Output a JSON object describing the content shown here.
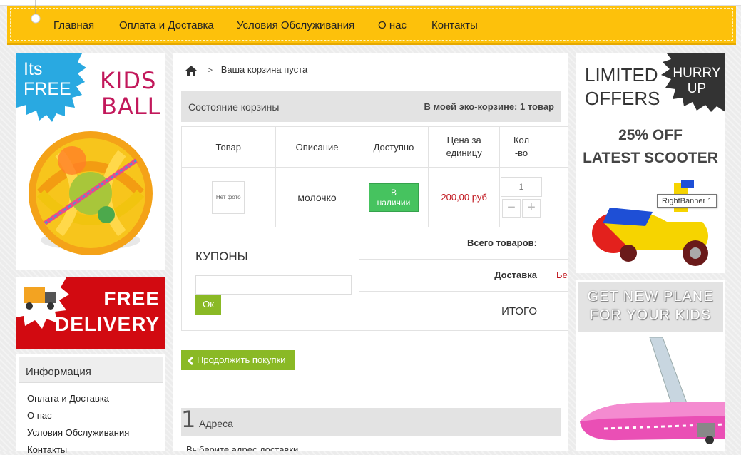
{
  "nav": {
    "items": [
      "Главная",
      "Оплата и Доставка",
      "Условия Обслуживания",
      "О нас",
      "Контакты"
    ]
  },
  "left_banner1": {
    "badge_line1": "Its",
    "badge_line2": "FREE",
    "title_line1": "KIDS",
    "title_line2": "BALL"
  },
  "left_banner2": {
    "line1": "FREE",
    "line2": "DELIVERY"
  },
  "info": {
    "title": "Информация",
    "links": [
      "Оплата и Доставка",
      "О нас",
      "Условия Обслуживания",
      "Контакты"
    ]
  },
  "breadcrumb": {
    "separator": ">",
    "current": "Ваша корзина пуста"
  },
  "cart": {
    "status_title": "Состояние корзины",
    "summary_prefix": "В моей эко-корзине:",
    "summary_count": "1 товар",
    "columns": [
      "Товар",
      "Описание",
      "Доступно",
      "Цена за единицу",
      "Кол-во"
    ],
    "item": {
      "photo": "Нет фото",
      "name": "молочко",
      "availability": "В наличии",
      "price": "200,00 руб",
      "qty": "1",
      "minus": "−",
      "plus": "+"
    },
    "coupons_title": "КУПОНЫ",
    "coupon_placeholder": "",
    "coupon_button": "Ок",
    "total_products_label": "Всего товаров:",
    "delivery_label": "Доставка",
    "delivery_value_cut": "Бе",
    "total_label": "ИТОГО",
    "continue_button": "Продолжить покупки"
  },
  "address": {
    "step": "1",
    "title": "Адреса",
    "choose": "Выберите адрес доставки"
  },
  "right_banner1": {
    "line1": "LIMITED",
    "line2": "OFFERS",
    "badge1": "HURRY",
    "badge2": "UP",
    "offer1": "25% OFF",
    "offer2": "LATEST SCOOTER",
    "tooltip": "RightBanner 1"
  },
  "right_banner2": {
    "line1": "GET NEW PLANE",
    "line2": "FOR YOUR KIDS"
  },
  "colors": {
    "nav_bg": "#fdc10b",
    "accent_green": "#8ab925",
    "instock_green": "#46c35f",
    "price_red": "#c0141c",
    "kids_ball_title": "#c2185b"
  }
}
